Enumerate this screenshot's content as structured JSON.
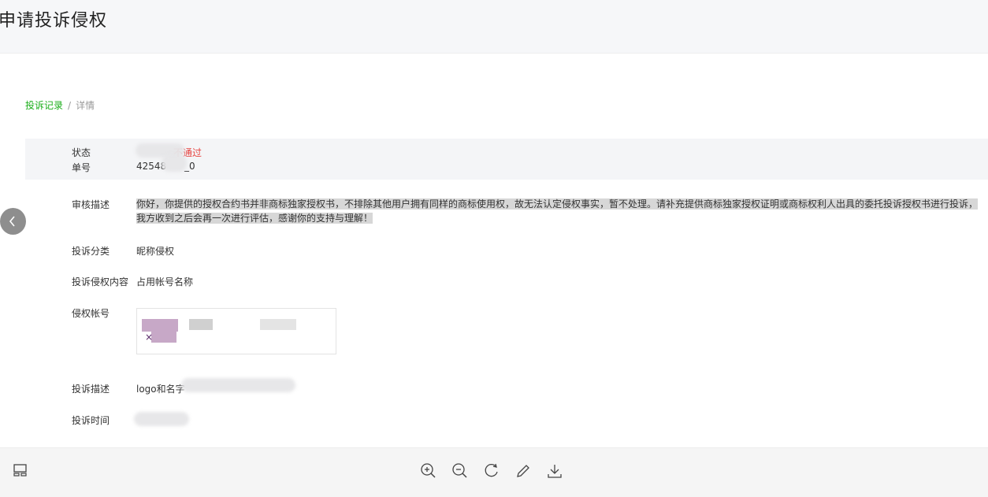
{
  "header": {
    "title": "申请投诉侵权"
  },
  "breadcrumb": {
    "link": "投诉记录",
    "separator": "/",
    "current": "详情"
  },
  "details": {
    "status_label": "状态",
    "status_value": "不通过",
    "order_label": "单号",
    "order_value": "42548",
    "order_suffix": "_0",
    "review_label": "审核描述",
    "review_text": "你好，你提供的授权合约书并非商标独家授权书，不排除其他用户拥有同样的商标使用权，故无法认定侵权事实，暂不处理。请补充提供商标独家授权证明或商标权利人出具的委托投诉授权书进行投诉，我方收到之后会再一次进行评估，感谢你的支持与理解！",
    "category_label": "投诉分类",
    "category_value": "昵称侵权",
    "content_label": "投诉侵权内容",
    "content_value": "占用帐号名称",
    "account_label": "侵权帐号",
    "account_close": "×",
    "complaint_desc_label": "投诉描述",
    "complaint_desc_value": "logo和名字",
    "time_label": "投诉时间"
  },
  "toolbar": {
    "icons": [
      "thumbnail-icon",
      "zoom-in-icon",
      "zoom-out-icon",
      "rotate-icon",
      "edit-icon",
      "download-icon"
    ]
  },
  "colors": {
    "accent": "#1aad19",
    "error": "#e64340",
    "header_bg": "#f6f7f9"
  }
}
